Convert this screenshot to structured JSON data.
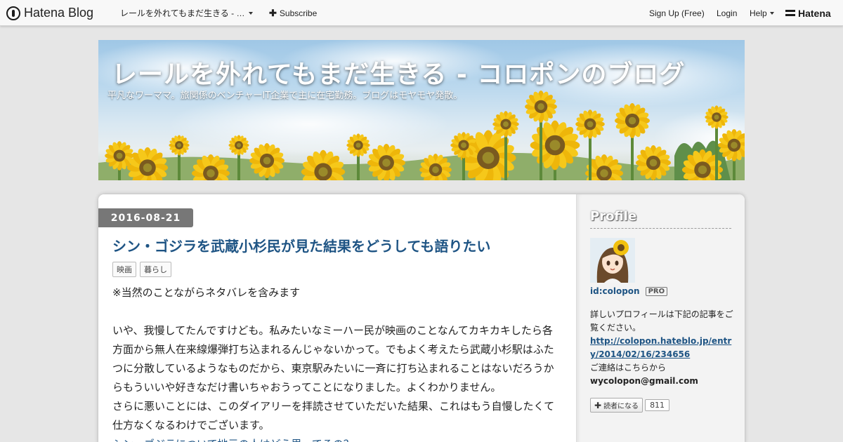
{
  "navbar": {
    "logo_text": "Hatena Blog",
    "blog_dropdown": "レールを外れてもまだ生きる - …",
    "subscribe": "Subscribe",
    "signup": "Sign Up (Free)",
    "login": "Login",
    "help": "Help",
    "hatena": "Hatena",
    "icons": [
      "hatena-blog-logo-icon",
      "caret-down-icon",
      "plus-icon",
      "hatena-logo-icon"
    ]
  },
  "header": {
    "title": "レールを外れてもまだ生きる - コロポンのブログ",
    "description": "平凡なワーママ。旅関係のベンチャーIT企業で主に在宅勤務。ブログはモヤモヤ発散。"
  },
  "entry": {
    "date": "2016-08-21",
    "title": "シン・ゴジラを武蔵小杉民が見た結果をどうしても語りたい",
    "tags": [
      "映画",
      "暮らし"
    ],
    "paragraphs": [
      "※当然のことながらネタバレを含みます",
      "いや、我慢してたんですけども。私みたいなミーハー民が映画のことなんてカキカキしたら各方面から無人在来線爆弾打ち込まれるんじゃないかって。でもよく考えたら武蔵小杉駅はふたつに分散しているようなものだから、東京駅みたいに一斉に打ち込まれることはないだろうからもういいや好きなだけ書いちゃおうってことになりました。よくわかりません。",
      "さらに悪いことには、このダイアリーを拝読させていただいた結果、これはもう自慢したくて仕方なくなるわけでございます。",
      "シン・ゴジラについて地元の人はどう思ってるの？"
    ]
  },
  "sidebar": {
    "heading": "Profile",
    "user_id": "id:colopon",
    "pro_badge": "PRO",
    "desc_line1": "詳しいプロフィールは下記の記事をご覧ください。",
    "profile_url": "http://colopon.hateblo.jp/entry/2014/02/16/234656",
    "contact_label": "ご連絡はこちらから",
    "email": "wycolopon@gmail.com",
    "reader_button": "読者になる",
    "reader_count": "811"
  },
  "colors": {
    "link": "#1e5484",
    "date_badge": "#777777",
    "sky_top": "#9fc7e6",
    "sunflower": "#f2c10f"
  }
}
